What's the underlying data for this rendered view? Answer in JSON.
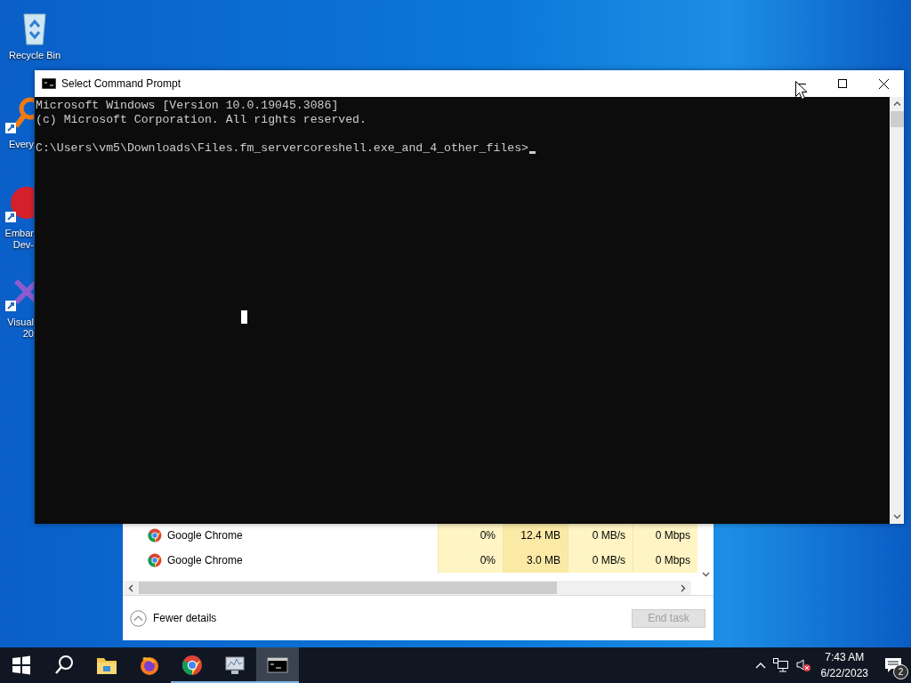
{
  "desktop_icons": [
    {
      "kind": "recycle",
      "lines": [
        "Recycle Bin"
      ]
    },
    {
      "kind": "search-app",
      "lines": [
        "Every"
      ]
    },
    {
      "kind": "dev",
      "lines": [
        "Embar",
        "Dev-"
      ]
    },
    {
      "kind": "studio",
      "lines": [
        "Visual",
        "20"
      ]
    }
  ],
  "task_manager": {
    "rows": [
      {
        "name": "Google Chrome",
        "cells": [
          "0%",
          "12.4 MB",
          "0 MB/s",
          "0 Mbps"
        ]
      },
      {
        "name": "Google Chrome",
        "cells": [
          "0%",
          "3.0 MB",
          "0 MB/s",
          "0 Mbps"
        ]
      }
    ],
    "details_toggle": "Fewer details",
    "end_task": {
      "label": "End task",
      "disabled": true
    }
  },
  "console_window": {
    "title": "Select Command Prompt",
    "lines": [
      "Microsoft Windows [Version 10.0.19045.3086]",
      "(c) Microsoft Corporation. All rights reserved."
    ],
    "prompt": "C:\\Users\\vm5\\Downloads\\Files.fm_servercoreshell.exe_and_4_other_files>"
  },
  "taskbar": {
    "items": [
      {
        "kind": "start",
        "running": false,
        "active": false
      },
      {
        "kind": "search",
        "running": false,
        "active": false
      },
      {
        "kind": "folder",
        "running": false,
        "active": false
      },
      {
        "kind": "firefox",
        "running": false,
        "active": false
      },
      {
        "kind": "chrome",
        "running": true,
        "active": false
      },
      {
        "kind": "monitor",
        "running": true,
        "active": false
      },
      {
        "kind": "console",
        "running": true,
        "active": true
      }
    ],
    "time": "7:43 AM",
    "date": "6/22/2023",
    "notifications": "2"
  }
}
